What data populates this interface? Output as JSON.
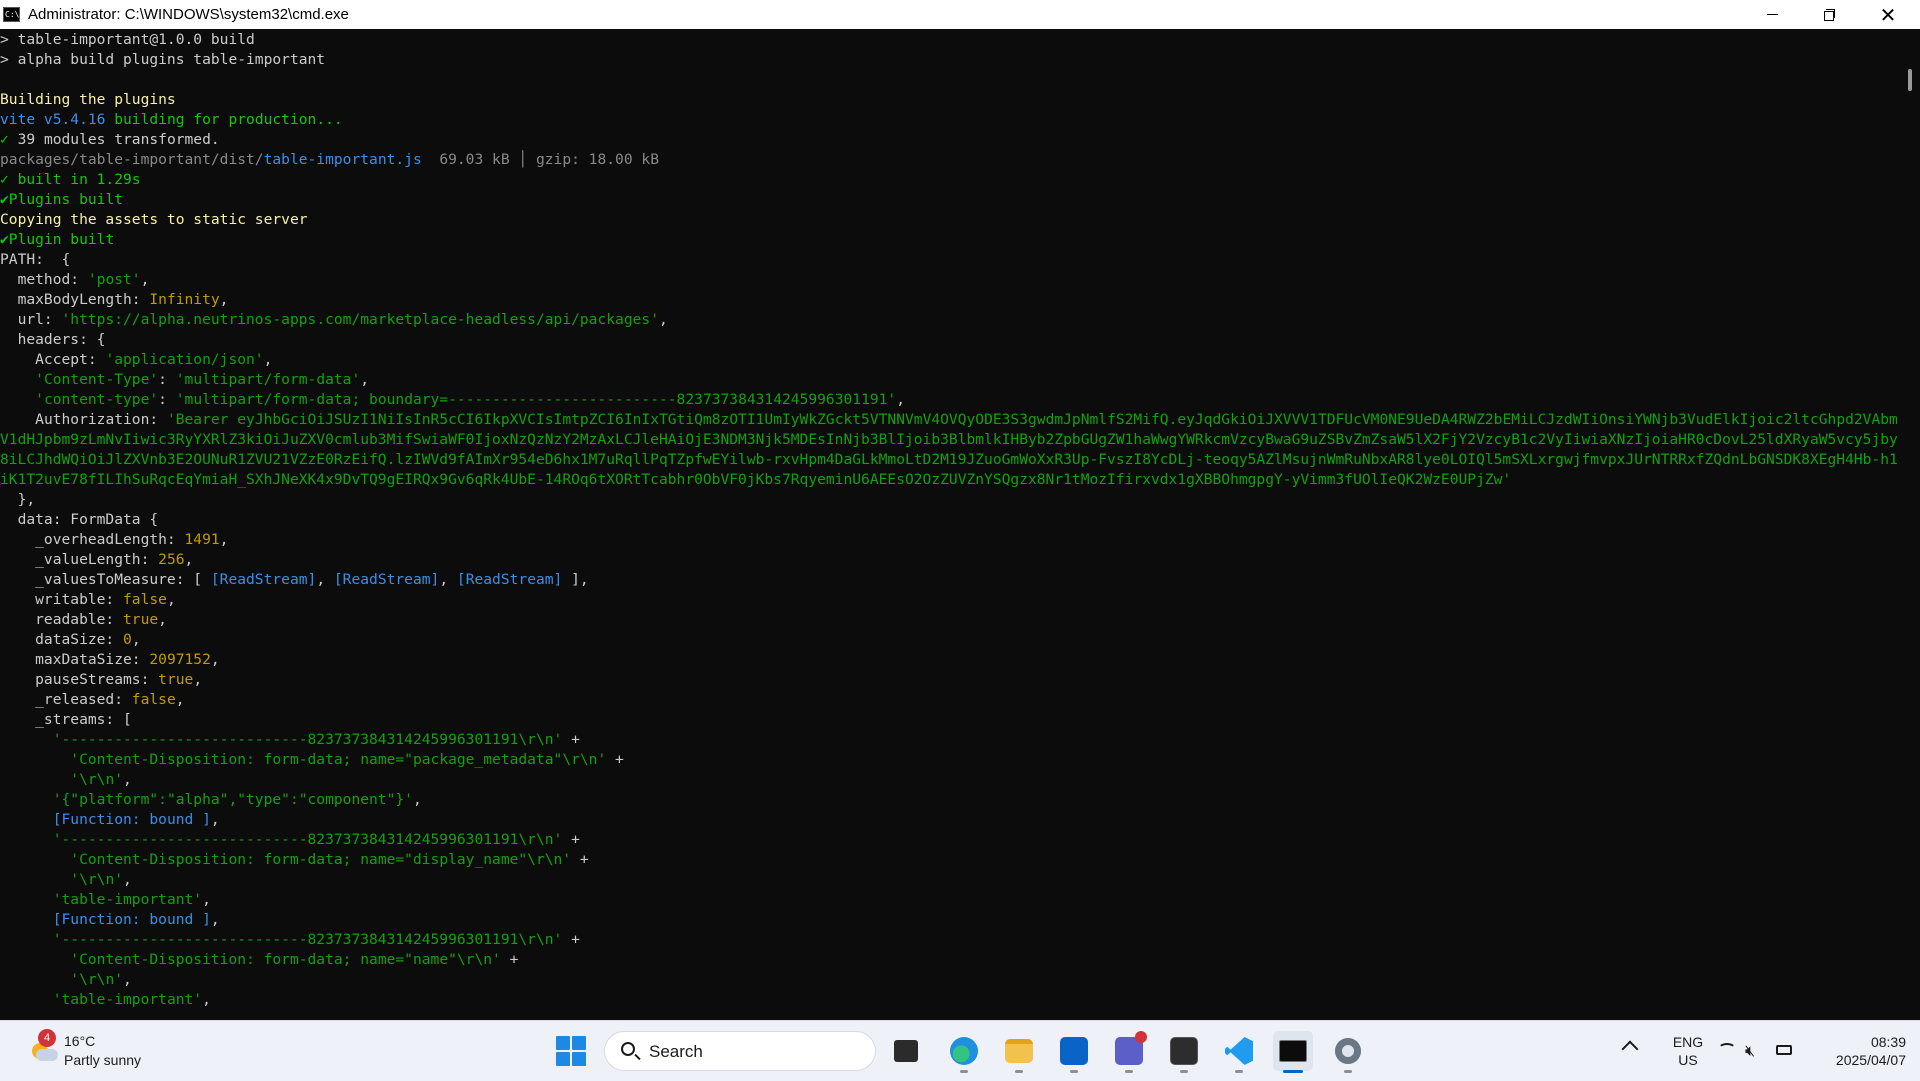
{
  "window": {
    "title": "Administrator:  C:\\WINDOWS\\system32\\cmd.exe",
    "app_icon_text": "C:\\"
  },
  "console_lines": [
    [
      {
        "t": "> table-important@1.0.0 build",
        "c": "default"
      }
    ],
    [
      {
        "t": "> alpha build plugins table-important",
        "c": "default"
      }
    ],
    [
      {
        "t": "",
        "c": "default"
      }
    ],
    [
      {
        "t": "Building the plugins",
        "c": "yellow"
      }
    ],
    [
      {
        "t": "vite v5.4.16 ",
        "c": "cyan"
      },
      {
        "t": "building for production...",
        "c": "green"
      }
    ],
    [
      {
        "t": "✓",
        "c": "green"
      },
      {
        "t": " 39 modules transformed.",
        "c": "default"
      }
    ],
    [
      {
        "t": "packages/table-important/dist/",
        "c": "gray"
      },
      {
        "t": "table-important.js",
        "c": "cyan"
      },
      {
        "t": "  69.03 kB │ gzip: 18.00 kB",
        "c": "gray"
      }
    ],
    [
      {
        "t": "✓ built in 1.29s",
        "c": "green"
      }
    ],
    [
      {
        "t": "✔",
        "c": "green"
      },
      {
        "t": "Plugins built",
        "c": "green"
      }
    ],
    [
      {
        "t": "Copying the assets to static server",
        "c": "yellow"
      }
    ],
    [
      {
        "t": "✔",
        "c": "green"
      },
      {
        "t": "Plugin built",
        "c": "green"
      }
    ],
    [
      {
        "t": "PATH:  {",
        "c": "default"
      }
    ],
    [
      {
        "t": "  method: ",
        "c": "default"
      },
      {
        "t": "'post'",
        "c": "strgreen"
      },
      {
        "t": ",",
        "c": "default"
      }
    ],
    [
      {
        "t": "  maxBodyLength: ",
        "c": "default"
      },
      {
        "t": "Infinity",
        "c": "olive"
      },
      {
        "t": ",",
        "c": "default"
      }
    ],
    [
      {
        "t": "  url: ",
        "c": "default"
      },
      {
        "t": "'https://alpha.neutrinos-apps.com/marketplace-headless/api/packages'",
        "c": "strgreen"
      },
      {
        "t": ",",
        "c": "default"
      }
    ],
    [
      {
        "t": "  headers: {",
        "c": "default"
      }
    ],
    [
      {
        "t": "    Accept: ",
        "c": "default"
      },
      {
        "t": "'application/json'",
        "c": "strgreen"
      },
      {
        "t": ",",
        "c": "default"
      }
    ],
    [
      {
        "t": "    ",
        "c": "default"
      },
      {
        "t": "'Content-Type'",
        "c": "strgreen"
      },
      {
        "t": ": ",
        "c": "default"
      },
      {
        "t": "'multipart/form-data'",
        "c": "strgreen"
      },
      {
        "t": ",",
        "c": "default"
      }
    ],
    [
      {
        "t": "    ",
        "c": "default"
      },
      {
        "t": "'content-type'",
        "c": "strgreen"
      },
      {
        "t": ": ",
        "c": "default"
      },
      {
        "t": "'multipart/form-data; boundary=--------------------------823737384314245996301191'",
        "c": "strgreen"
      },
      {
        "t": ",",
        "c": "default"
      }
    ],
    [
      {
        "t": "    Authorization: ",
        "c": "default"
      },
      {
        "t": "'Bearer eyJhbGciOiJSUzI1NiIsInR5cCI6IkpXVCIsImtpZCI6InIxTGtiQm8zOTI1UmIyWkZGckt5VTNNVmV4OVQyODE3S3gwdmJpNmlfS2MifQ.eyJqdGkiOiJXVVV1TDFUcVM0NE9UeDA4RWZ2bEMiLCJzdWIiOnsiYWNjb3VudElkIjoic2ltcGhpd2VAbmV1dHJpbm9zLmNvIiwic3RyYXRlZ3kiOiJuZXV0cmlub3MifSwiaWF0IjoxNzQzNzY2MzAxLCJleHAiOjE3NDM3Njk5MDEsInNjb3BlIjoib3BlbmlkIHByb2ZpbGUgZW1haWwgYWRkcmVzcyBwaG9uZSBvZmZsaW5lX2FjY2VzcyB1c2VyIiwiaXNzIjoiaHR0cDovL25ldXRyaW5vcy5jby8iLCJhdWQiOiJlZXVnb3E2OUNuR1ZVU21VZzE0RzEifQ.lzIWVd9fAImXr954eD6hx1M7uRqllPqTZpfwEYilwb-rxvHpm4DaGLkMmoLtD2M19JZuoGmWoXxR3Up-FvszI8YcDLj-teoqy5AZlMsujnWmRuNbxAR8lye0LOIQl5mSXLxrgwjfmvpxJUrNTRRxfZQdnLbGNSDK8XEgH4Hb-h1iK1T2uvE78fILIhSuRqcEqYmiaH_SXhJNeXK4x9DvTQ9gEIRQx9Gv6qRk4UbE-14ROq6tXORtTcabhr0ObVF0jKbs7RqyeminU6AEEsO2OzZUVZnYSQgzx8Nr1tMozIfirxvdx1gXBBOhmgpgY-yVimm3fUOlIeQK2WzE0UPjZw'",
        "c": "strgreen",
        "wrap": true
      }
    ],
    [
      {
        "t": "  },",
        "c": "default"
      }
    ],
    [
      {
        "t": "  data: FormData {",
        "c": "default"
      }
    ],
    [
      {
        "t": "    _overheadLength: ",
        "c": "default"
      },
      {
        "t": "1491",
        "c": "olive"
      },
      {
        "t": ",",
        "c": "default"
      }
    ],
    [
      {
        "t": "    _valueLength: ",
        "c": "default"
      },
      {
        "t": "256",
        "c": "olive"
      },
      {
        "t": ",",
        "c": "default"
      }
    ],
    [
      {
        "t": "    _valuesToMeasure: [ ",
        "c": "default"
      },
      {
        "t": "[ReadStream]",
        "c": "cyan"
      },
      {
        "t": ", ",
        "c": "default"
      },
      {
        "t": "[ReadStream]",
        "c": "cyan"
      },
      {
        "t": ", ",
        "c": "default"
      },
      {
        "t": "[ReadStream]",
        "c": "cyan"
      },
      {
        "t": " ],",
        "c": "default"
      }
    ],
    [
      {
        "t": "    writable: ",
        "c": "default"
      },
      {
        "t": "false",
        "c": "olive"
      },
      {
        "t": ",",
        "c": "default"
      }
    ],
    [
      {
        "t": "    readable: ",
        "c": "default"
      },
      {
        "t": "true",
        "c": "olive"
      },
      {
        "t": ",",
        "c": "default"
      }
    ],
    [
      {
        "t": "    dataSize: ",
        "c": "default"
      },
      {
        "t": "0",
        "c": "olive"
      },
      {
        "t": ",",
        "c": "default"
      }
    ],
    [
      {
        "t": "    maxDataSize: ",
        "c": "default"
      },
      {
        "t": "2097152",
        "c": "olive"
      },
      {
        "t": ",",
        "c": "default"
      }
    ],
    [
      {
        "t": "    pauseStreams: ",
        "c": "default"
      },
      {
        "t": "true",
        "c": "olive"
      },
      {
        "t": ",",
        "c": "default"
      }
    ],
    [
      {
        "t": "    _released: ",
        "c": "default"
      },
      {
        "t": "false",
        "c": "olive"
      },
      {
        "t": ",",
        "c": "default"
      }
    ],
    [
      {
        "t": "    _streams: [",
        "c": "default"
      }
    ],
    [
      {
        "t": "      ",
        "c": "default"
      },
      {
        "t": "'----------------------------823737384314245996301191\\r\\n'",
        "c": "strgreen"
      },
      {
        "t": " +",
        "c": "default"
      }
    ],
    [
      {
        "t": "        ",
        "c": "default"
      },
      {
        "t": "'Content-Disposition: form-data; name=\"package_metadata\"\\r\\n'",
        "c": "strgreen"
      },
      {
        "t": " +",
        "c": "default"
      }
    ],
    [
      {
        "t": "        ",
        "c": "default"
      },
      {
        "t": "'\\r\\n'",
        "c": "strgreen"
      },
      {
        "t": ",",
        "c": "default"
      }
    ],
    [
      {
        "t": "      ",
        "c": "default"
      },
      {
        "t": "'{\"platform\":\"alpha\",\"type\":\"component\"}'",
        "c": "strgreen"
      },
      {
        "t": ",",
        "c": "default"
      }
    ],
    [
      {
        "t": "      ",
        "c": "default"
      },
      {
        "t": "[Function: bound ]",
        "c": "cyan"
      },
      {
        "t": ",",
        "c": "default"
      }
    ],
    [
      {
        "t": "      ",
        "c": "default"
      },
      {
        "t": "'----------------------------823737384314245996301191\\r\\n'",
        "c": "strgreen"
      },
      {
        "t": " +",
        "c": "default"
      }
    ],
    [
      {
        "t": "        ",
        "c": "default"
      },
      {
        "t": "'Content-Disposition: form-data; name=\"display_name\"\\r\\n'",
        "c": "strgreen"
      },
      {
        "t": " +",
        "c": "default"
      }
    ],
    [
      {
        "t": "        ",
        "c": "default"
      },
      {
        "t": "'\\r\\n'",
        "c": "strgreen"
      },
      {
        "t": ",",
        "c": "default"
      }
    ],
    [
      {
        "t": "      ",
        "c": "default"
      },
      {
        "t": "'table-important'",
        "c": "strgreen"
      },
      {
        "t": ",",
        "c": "default"
      }
    ],
    [
      {
        "t": "      ",
        "c": "default"
      },
      {
        "t": "[Function: bound ]",
        "c": "cyan"
      },
      {
        "t": ",",
        "c": "default"
      }
    ],
    [
      {
        "t": "      ",
        "c": "default"
      },
      {
        "t": "'----------------------------823737384314245996301191\\r\\n'",
        "c": "strgreen"
      },
      {
        "t": " +",
        "c": "default"
      }
    ],
    [
      {
        "t": "        ",
        "c": "default"
      },
      {
        "t": "'Content-Disposition: form-data; name=\"name\"\\r\\n'",
        "c": "strgreen"
      },
      {
        "t": " +",
        "c": "default"
      }
    ],
    [
      {
        "t": "        ",
        "c": "default"
      },
      {
        "t": "'\\r\\n'",
        "c": "strgreen"
      },
      {
        "t": ",",
        "c": "default"
      }
    ],
    [
      {
        "t": "      ",
        "c": "default"
      },
      {
        "t": "'table-important'",
        "c": "strgreen"
      },
      {
        "t": ",",
        "c": "default"
      }
    ]
  ],
  "taskbar": {
    "weather": {
      "badge": "4",
      "temp": "16°C",
      "desc": "Partly sunny",
      "icon": "partly-sunny-icon"
    },
    "search_label": "Search",
    "apps": [
      {
        "id": "taskview",
        "name": "task-view-button"
      },
      {
        "id": "edge",
        "name": "edge-button"
      },
      {
        "id": "explorer",
        "name": "file-explorer-button"
      },
      {
        "id": "outlook",
        "name": "outlook-button"
      },
      {
        "id": "teams",
        "name": "teams-button"
      },
      {
        "id": "terminal",
        "name": "terminal-button"
      },
      {
        "id": "vscode",
        "name": "vscode-button"
      },
      {
        "id": "cmd",
        "name": "cmd-button"
      },
      {
        "id": "settings",
        "name": "settings-button"
      }
    ],
    "lang_line1": "ENG",
    "lang_line2": "US",
    "time": "08:39",
    "date": "2025/04/07"
  },
  "colors": {
    "console_bg": "#0c0c0c",
    "accent": "#0067c0"
  }
}
